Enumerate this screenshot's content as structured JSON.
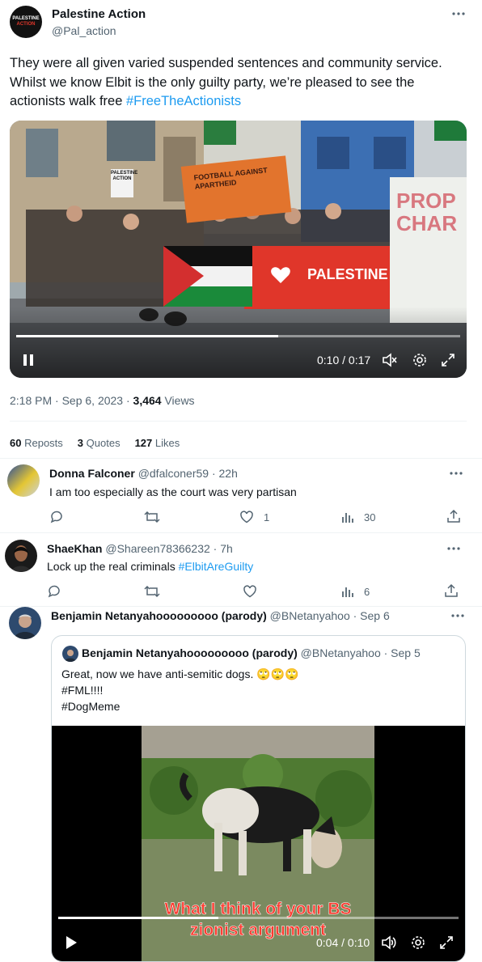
{
  "post": {
    "author_name": "Palestine Action",
    "author_handle": "@Pal_action",
    "avatar_text_top": "PALESTINE",
    "avatar_text_bottom": "ACTION",
    "text_main": "They were all given varied suspended sentences and community service. Whilst we know Elbit is the only guilty party, we’re pleased to see the actionists walk free ",
    "hashtag": "#FreeTheActionists",
    "video": {
      "time": "0:10 / 0:17",
      "progress": 0.59,
      "banner_text": "PALESTINE",
      "banner_left_text": "FOOTBALL AGAINST APARTHEID",
      "sign_text": "PALESTINE ACTION",
      "right_banner_text": "PROP CHAR"
    },
    "timestamp": "2:18 PM · Sep 6, 2023 · ",
    "views_count": "3,464",
    "views_label": " Views"
  },
  "stats": {
    "reposts_count": "60",
    "reposts_label": "Reposts",
    "quotes_count": "3",
    "quotes_label": "Quotes",
    "likes_count": "127",
    "likes_label": "Likes"
  },
  "replies": [
    {
      "name": "Donna Falconer",
      "handle": "@dfalconer59 · 22h",
      "text": "I am too especially as the court was very partisan",
      "like_count": "1",
      "views_count": "30"
    },
    {
      "name": "ShaeKhan",
      "handle": "@Shareen78366232 · 7h",
      "text": "Lock up the real criminals ",
      "hashtag": "#ElbitAreGuilty",
      "like_count": "",
      "views_count": "6"
    },
    {
      "name": "Benjamin Netanyahooooooooo (parody)",
      "handle": "@BNetanyahoo · Sep 6"
    }
  ],
  "quote": {
    "name": "Benjamin Netanyahooooooooo (parody)",
    "handle": "@BNetanyahoo · Sep 5",
    "line1": "Great, now we have anti-semitic dogs. ",
    "emojis": "🙄🙄🙄",
    "line2": "#FML!!!!",
    "line3": "#DogMeme",
    "video": {
      "caption_line1": "What I think of your BS",
      "caption_line2": "zionist argument",
      "time": "0:04 / 0:10",
      "progress": 0.4
    }
  },
  "colors": {
    "accent": "#1d9bf0",
    "banner_red": "#e0362a",
    "caption_red": "#ff3b30"
  }
}
